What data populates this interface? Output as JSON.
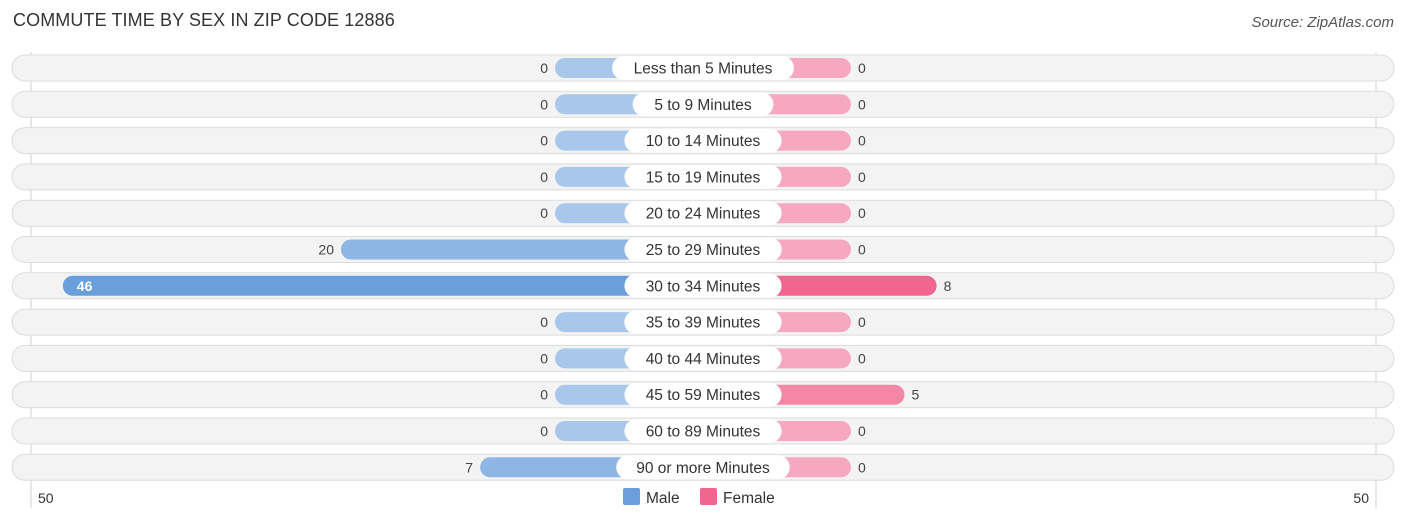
{
  "header": {
    "title": "COMMUTE TIME BY SEX IN ZIP CODE 12886",
    "source": "Source: ZipAtlas.com"
  },
  "chart_data": {
    "type": "bar",
    "orientation": "horizontal-diverging",
    "title": "COMMUTE TIME BY SEX IN ZIP CODE 12886",
    "categories": [
      "Less than 5 Minutes",
      "5 to 9 Minutes",
      "10 to 14 Minutes",
      "15 to 19 Minutes",
      "20 to 24 Minutes",
      "25 to 29 Minutes",
      "30 to 34 Minutes",
      "35 to 39 Minutes",
      "40 to 44 Minutes",
      "45 to 59 Minutes",
      "60 to 89 Minutes",
      "90 or more Minutes"
    ],
    "series": [
      {
        "name": "Male",
        "color": "#6a9fdc",
        "light_color": "#a9c7ea",
        "values": [
          0,
          0,
          0,
          0,
          0,
          20,
          46,
          0,
          0,
          0,
          0,
          7
        ]
      },
      {
        "name": "Female",
        "color": "#f0668f",
        "light_color": "#f6a8c0",
        "values": [
          0,
          0,
          0,
          0,
          0,
          0,
          8,
          0,
          0,
          5,
          0,
          0
        ]
      }
    ],
    "axis": {
      "left_max_label": "50",
      "right_max_label": "50",
      "max": 50
    },
    "legend": {
      "position": "bottom-center",
      "entries": [
        "Male",
        "Female"
      ]
    }
  }
}
